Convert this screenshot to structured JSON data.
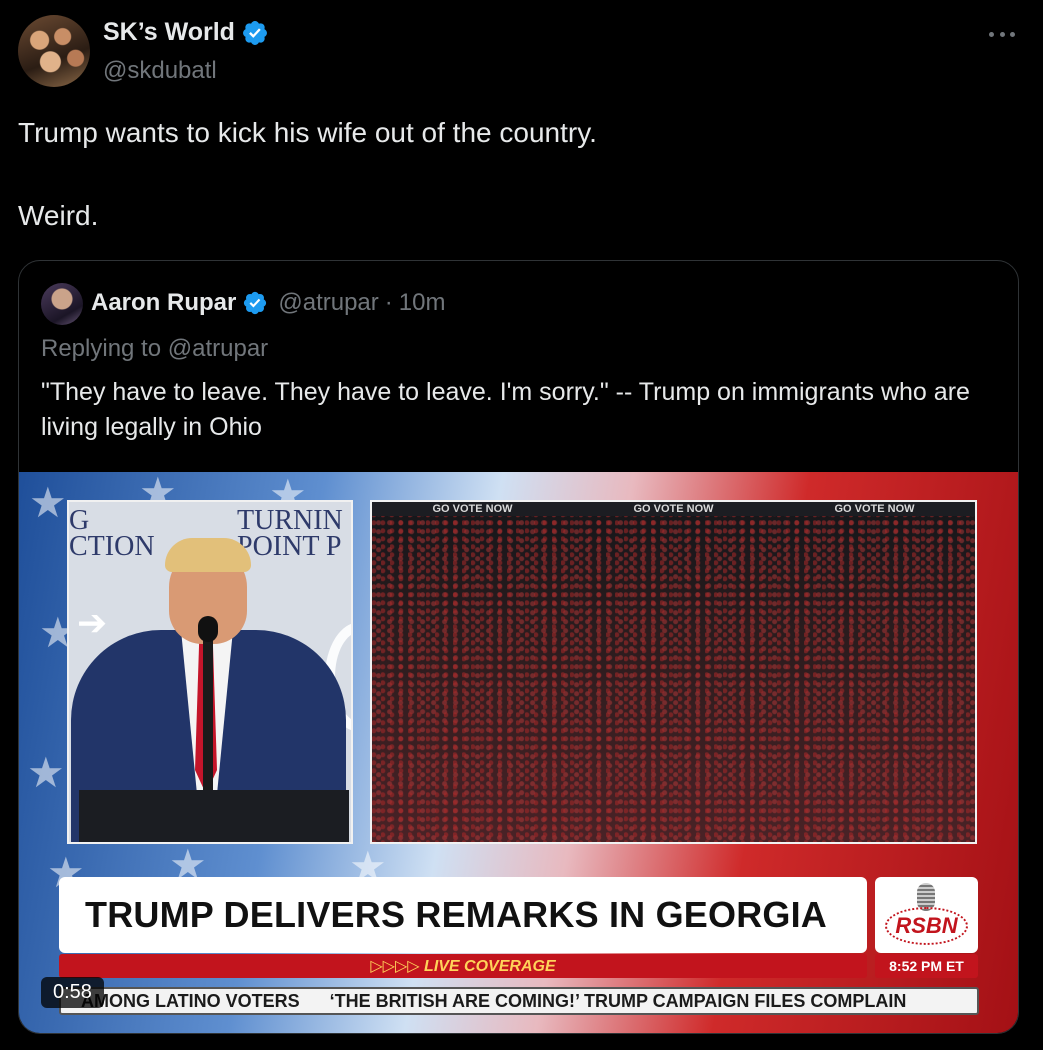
{
  "author": {
    "display_name": "SK’s World",
    "handle": "@skdubatl"
  },
  "tweet": {
    "line1": "Trump wants to kick his wife out of the country.",
    "line2": "Weird."
  },
  "quoted": {
    "display_name": "Aaron Rupar",
    "handle": "@atrupar",
    "separator": "·",
    "time": "10m",
    "replying_prefix": "Replying to",
    "replying_handle": "@atrupar",
    "text": "\"They have to leave. They have to leave. I'm sorry.\" -- Trump on immigrants who are living legally in Ohio"
  },
  "video": {
    "backdrop_left": "G\nCTION",
    "backdrop_right": "TURNIN\nPOINT P",
    "banner_items": [
      "GO VOTE NOW",
      "GO VOTE NOW",
      "GO VOTE NOW"
    ],
    "headline": "TRUMP DELIVERS REMARKS IN GEORGIA",
    "live_label": "▷▷▷▷ LIVE COVERAGE",
    "logo": "RSBN",
    "clock": "8:52 PM ET",
    "ticker_items": [
      "AMONG LATINO VOTERS",
      "‘THE BRITISH ARE COMING!’ TRUMP CAMPAIGN FILES COMPLAIN"
    ],
    "duration": "0:58"
  },
  "icons": {
    "verified": "verified-badge-icon",
    "more": "more-options-icon"
  },
  "colors": {
    "background": "#000000",
    "text": "#e7e9ea",
    "muted": "#71767b",
    "verified": "#1d9bf0",
    "border": "#2f3336"
  }
}
